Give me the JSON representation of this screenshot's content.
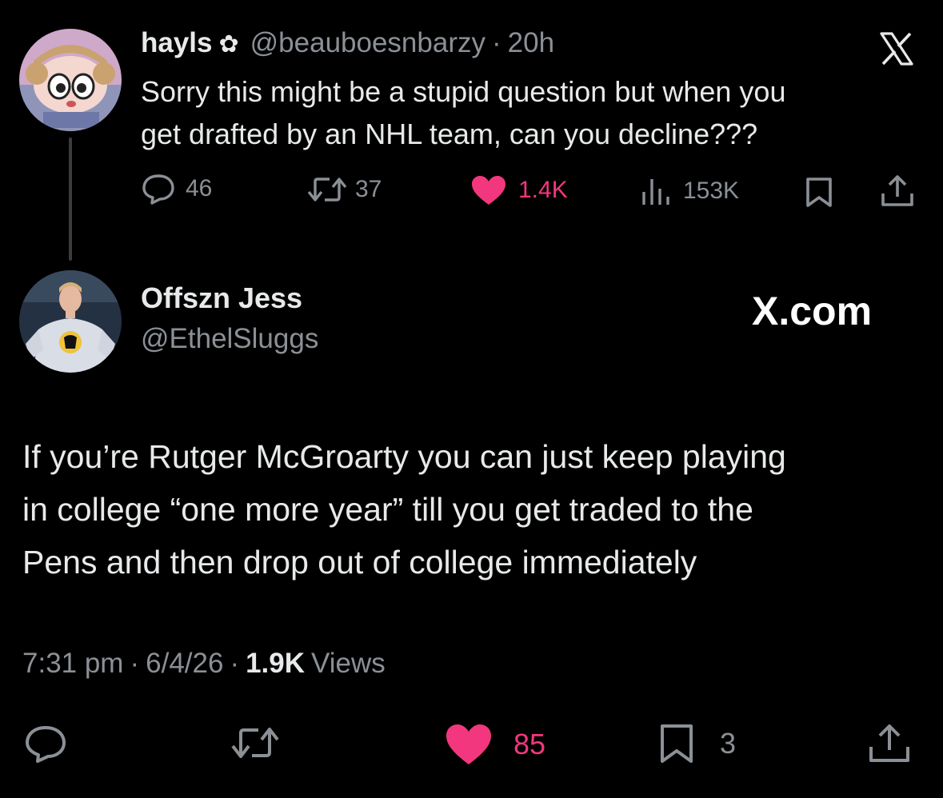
{
  "parent_tweet": {
    "display_name": "hayls",
    "name_emoji": "✿",
    "handle": "@beauboesnbarzy",
    "separator": "·",
    "time": "20h",
    "text_line1": "Sorry this might be a stupid question but when you",
    "text_line2": "get drafted by an NHL team, can you decline???",
    "replies": "46",
    "retweets": "37",
    "likes": "1.4K",
    "views": "153K"
  },
  "main_tweet": {
    "display_name": "Offszn Jess",
    "handle": "@EthelSluggs",
    "brand": "X.com",
    "text_line1": "If you’re Rutger McGroarty you can just keep playing",
    "text_line2": "in college “one more year” till you get traded to the",
    "text_line3": "Pens and then drop out of college immediately",
    "time": "7:31 pm",
    "date": "6/4/26",
    "sep": "·",
    "views_count": "1.9K",
    "views_label": "Views",
    "likes": "85",
    "bookmarks": "3"
  },
  "colors": {
    "background": "#000000",
    "text": "#e7e9ea",
    "muted": "#8b9096",
    "like_pink": "#f2377e"
  },
  "icons": [
    "x-logo-icon",
    "reply-icon",
    "retweet-icon",
    "heart-icon",
    "views-icon",
    "bookmark-icon",
    "share-icon"
  ]
}
